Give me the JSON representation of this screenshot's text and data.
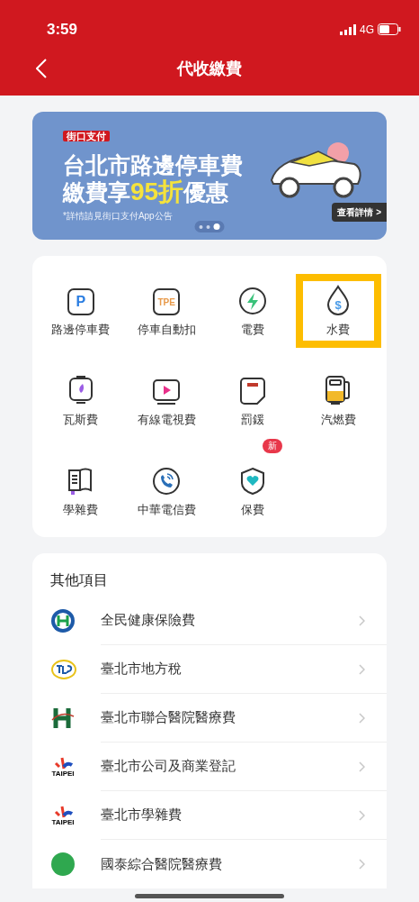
{
  "status_bar": {
    "time": "3:59",
    "network": "4G"
  },
  "header": {
    "title": "代收繳費"
  },
  "banner": {
    "brand": "街口支付",
    "line1": "台北市路邊停車費",
    "line2_before": "繳費享",
    "line2_highlight": "95折",
    "line2_after": "優惠",
    "note": "*詳情請見街口支付App公告",
    "detail_button": "查看詳情 >",
    "dots": [
      {
        "selected": false
      },
      {
        "selected": false
      },
      {
        "selected": true
      }
    ]
  },
  "services": [
    {
      "label": "路邊停車費",
      "icon_text": "P",
      "selected": false
    },
    {
      "label": "停車自動扣",
      "icon_text": "TPE",
      "selected": false
    },
    {
      "label": "電費",
      "selected": false
    },
    {
      "label": "水費",
      "icon_text": "$",
      "selected": true
    },
    {
      "label": "瓦斯費",
      "selected": false
    },
    {
      "label": "有線電視費",
      "selected": false
    },
    {
      "label": "罰鍰",
      "selected": false
    },
    {
      "label": "汽燃費",
      "selected": false
    },
    {
      "label": "學雜費",
      "selected": false
    },
    {
      "label": "中華電信費",
      "selected": false
    },
    {
      "label": "保費",
      "badge": "新",
      "selected": false
    }
  ],
  "other": {
    "title": "其他項目",
    "items": [
      {
        "label": "全民健康保險費"
      },
      {
        "label": "臺北市地方稅"
      },
      {
        "label": "臺北市聯合醫院醫療費"
      },
      {
        "label": "臺北市公司及商業登記",
        "logo_text": "TAIPEI"
      },
      {
        "label": "臺北市學雜費",
        "logo_text": "TAIPEI"
      },
      {
        "label": "國泰綜合醫院醫療費"
      }
    ]
  }
}
